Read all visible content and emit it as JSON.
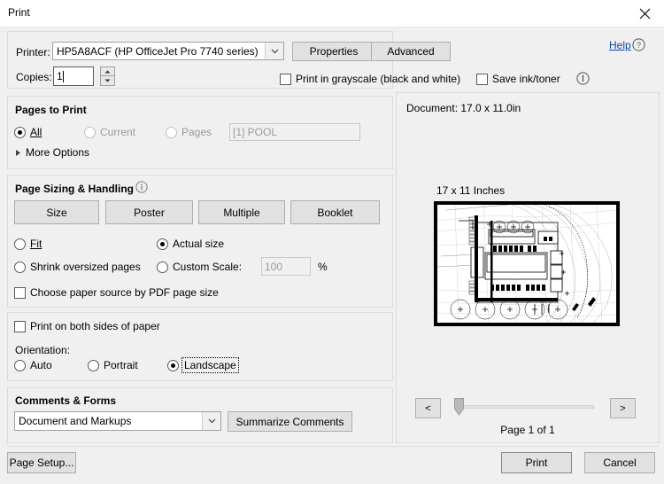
{
  "window": {
    "title": "Print",
    "close_icon": "close-icon"
  },
  "printer_section": {
    "printer_label": "Printer:",
    "printer_value": "HP5A8ACF (HP OfficeJet Pro 7740 series)",
    "properties_button": "Properties",
    "advanced_button": "Advanced",
    "help_link": "Help",
    "help_icon": "help-circle-icon",
    "copies_label": "Copies:",
    "copies_value": "1",
    "grayscale_label": "Print in grayscale (black and white)",
    "grayscale_checked": false,
    "save_ink_label": "Save ink/toner",
    "save_ink_checked": false,
    "info_icon": "info-circle-icon"
  },
  "pages_to_print": {
    "title": "Pages to Print",
    "all_label": "All",
    "current_label": "Current",
    "pages_label": "Pages",
    "selected": "All",
    "pages_value": "[1] POOL",
    "more_options_label": "More Options",
    "more_options_icon": "chevron-right-icon"
  },
  "page_sizing": {
    "title": "Page Sizing & Handling",
    "info_icon": "info-circle-icon",
    "mode_buttons": [
      "Size",
      "Poster",
      "Multiple",
      "Booklet"
    ],
    "active_mode": "Size",
    "fit_label": "Fit",
    "actual_size_label": "Actual size",
    "shrink_label": "Shrink oversized pages",
    "custom_scale_label": "Custom Scale:",
    "custom_scale_value": "100",
    "percent_label": "%",
    "scale_selected": "Actual size",
    "paper_source_label": "Choose paper source by PDF page size",
    "paper_source_checked": false
  },
  "duplex_orientation": {
    "both_sides_label": "Print on both sides of paper",
    "both_sides_checked": false,
    "orientation_label": "Orientation:",
    "auto_label": "Auto",
    "portrait_label": "Portrait",
    "landscape_label": "Landscape",
    "selected": "Landscape"
  },
  "comments_forms": {
    "title": "Comments & Forms",
    "dropdown_value": "Document and Markups",
    "dropdown_icon": "chevron-down-icon",
    "summarize_button": "Summarize Comments"
  },
  "preview": {
    "document_size": "Document: 17.0 x 11.0in",
    "paper_size": "17 x 11 Inches",
    "prev_button": "<",
    "next_button": ">",
    "page_indicator": "Page 1 of 1",
    "prev_icon": "chevron-left-icon",
    "next_icon": "chevron-right-icon",
    "slider_value": 0
  },
  "footer": {
    "page_setup_button": "Page Setup...",
    "print_button": "Print",
    "cancel_button": "Cancel"
  },
  "colors": {
    "dialog_bg": "#f0f0f0",
    "panel_border": "#dcdcdc",
    "button_face": "#e1e1e1",
    "link_blue": "#0645ad",
    "text": "#000000",
    "disabled_text": "#9a9a9a"
  }
}
